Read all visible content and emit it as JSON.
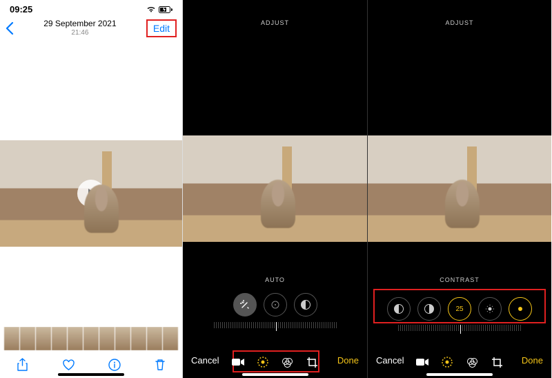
{
  "screen1": {
    "status": {
      "time": "09:25"
    },
    "nav": {
      "date": "29 September 2021",
      "time": "21:46",
      "edit": "Edit"
    }
  },
  "screen2": {
    "header": "ADJUST",
    "sub": "AUTO",
    "cancel": "Cancel",
    "done": "Done"
  },
  "screen3": {
    "header": "ADJUST",
    "sub": "CONTRAST",
    "value": "25",
    "cancel": "Cancel",
    "done": "Done"
  }
}
